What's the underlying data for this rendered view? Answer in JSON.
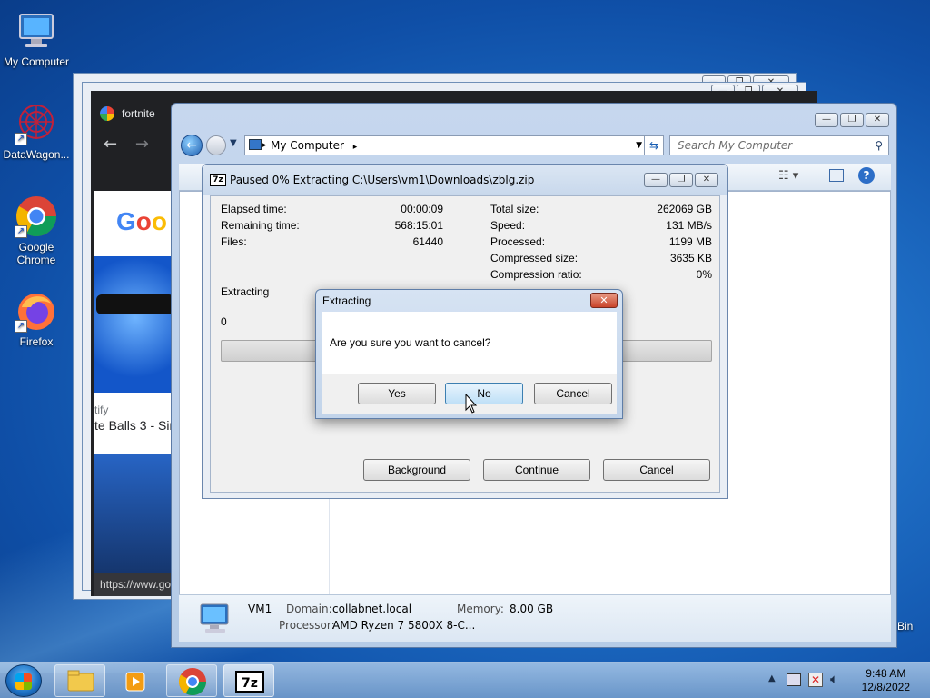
{
  "desktop": {
    "icons": [
      {
        "label": "My Computer"
      },
      {
        "label": "DataWagon..."
      },
      {
        "label": "Google Chrome"
      },
      {
        "label": "Firefox"
      }
    ],
    "recycle_bin_partial": "Bin"
  },
  "chrome": {
    "tab_title": "fortnite",
    "status_url": "https://www.go",
    "page_snippet_1": "tify",
    "page_snippet_2": "te Balls 3 - Sin"
  },
  "explorer": {
    "address": "My Computer",
    "search_placeholder": "Search My Computer",
    "details": {
      "name": "VM1",
      "domain_label": "Domain:",
      "domain": "collabnet.local",
      "memory_label": "Memory:",
      "memory": "8.00 GB",
      "processor_label": "Processor:",
      "processor": "AMD Ryzen 7 5800X 8-C..."
    }
  },
  "zip": {
    "title": "Paused 0% Extracting C:\\Users\\vm1\\Downloads\\zblg.zip",
    "left": [
      {
        "label": "Elapsed time:",
        "value": "00:00:09"
      },
      {
        "label": "Remaining time:",
        "value": "568:15:01"
      },
      {
        "label": "Files:",
        "value": "61440"
      }
    ],
    "right": [
      {
        "label": "Total size:",
        "value": "262069 GB"
      },
      {
        "label": "Speed:",
        "value": "131 MB/s"
      },
      {
        "label": "Processed:",
        "value": "1199 MB"
      },
      {
        "label": "Compressed size:",
        "value": "3635 KB"
      },
      {
        "label": "Compression ratio:",
        "value": "0%"
      }
    ],
    "status": "Extracting",
    "count": "0",
    "progress": 0,
    "buttons": {
      "background": "Background",
      "continue": "Continue",
      "cancel": "Cancel"
    }
  },
  "dialog": {
    "title": "Extracting",
    "message": "Are you sure you want to cancel?",
    "buttons": {
      "yes": "Yes",
      "no": "No",
      "cancel": "Cancel"
    }
  },
  "taskbar": {
    "time": "9:48 AM",
    "date": "12/8/2022"
  }
}
